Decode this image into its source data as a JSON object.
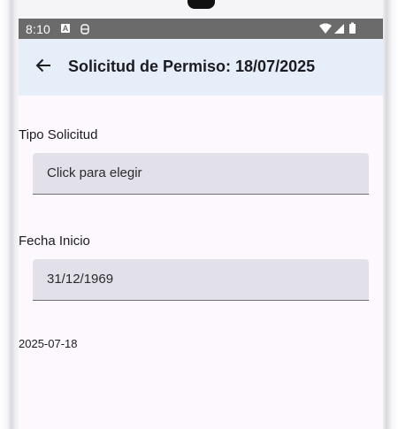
{
  "status_bar": {
    "time": "8:10",
    "notification_icon": "A",
    "icons": [
      "wifi-icon",
      "signal-icon",
      "battery-icon"
    ]
  },
  "app_bar": {
    "title": "Solicitud de Permiso: 18/07/2025",
    "back_icon": "arrow-left-icon"
  },
  "form": {
    "tipo_solicitud": {
      "label": "Tipo Solicitud",
      "value": "Click para elegir"
    },
    "fecha_inicio": {
      "label": "Fecha Inicio",
      "value": "31/12/1969"
    },
    "date_text": "2025-07-18"
  },
  "colors": {
    "status_bar": "#6b6b6b",
    "app_bar": "#e6eef9",
    "background": "#fcf8fe",
    "field": "#e2e1ea"
  }
}
